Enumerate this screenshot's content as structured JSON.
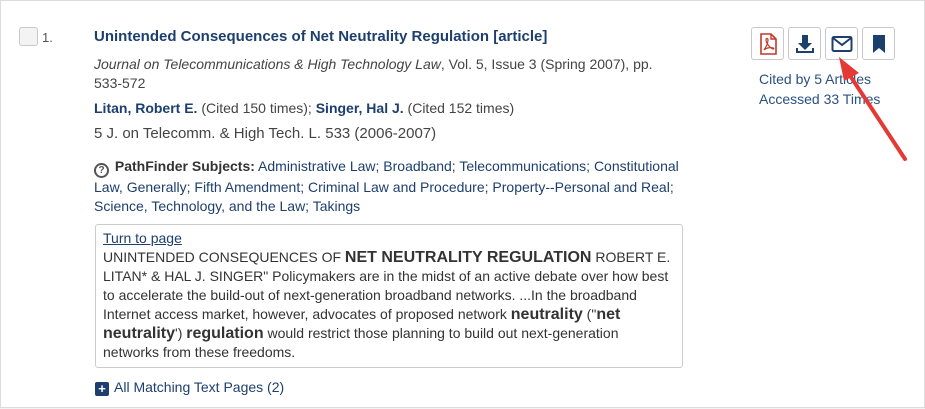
{
  "result": {
    "number": "1.",
    "title": "Unintended Consequences of Net Neutrality Regulation [article]",
    "journal": {
      "name": "Journal on Telecommunications & High Technology Law",
      "details": ", Vol. 5, Issue 3 (Spring 2007), pp. 533-572"
    },
    "authors": [
      {
        "name": "Litan, Robert E.",
        "cited": " (Cited 150 times);"
      },
      {
        "name": "Singer, Hal J.",
        "cited": " (Cited 152 times)"
      }
    ],
    "citation": "5 J. on Telecomm. & High Tech. L. 533 (2006-2007)",
    "subjects": {
      "help_icon": "?",
      "label": "PathFinder Subjects:",
      "list": " Administrative Law; Broadband; Telecommunications; Constitutional Law, Generally; Fifth Amendment; Criminal Law and Procedure; Property--Personal and Real; Science, Technology, and the Law; Takings"
    },
    "snippet": {
      "link": "Turn to page",
      "p1": "UNINTENDED CONSEQUENCES OF ",
      "h1": "NET NEUTRALITY REGULATION",
      "p2": " ROBERT E. LITAN* & HAL J. SINGER\" Policymakers are in the midst of an active debate over how best to accelerate the build-out of next-generation broadband networks. ...In the broadband Internet access market, however, advocates of proposed network ",
      "h2": "neutrality",
      "p3": " (\"",
      "h3": "net neutrality",
      "p4": "') ",
      "h4": "regulation",
      "p5": " would restrict those planning to build out next-generation networks from these freedoms."
    },
    "all_matching": "All Matching Text Pages (2)",
    "plus_icon": "+",
    "actions": {
      "pdf_icon": "pdf-icon",
      "download_icon": "download-icon",
      "email_icon": "envelope-icon",
      "bookmark_icon": "bookmark-icon"
    },
    "stats": {
      "cited_by": "Cited by 5 Articles",
      "accessed": "Accessed 33 Times"
    }
  },
  "colors": {
    "link": "#1d3f6e",
    "pdf": "#c0392b",
    "arrow": "#e53935"
  }
}
